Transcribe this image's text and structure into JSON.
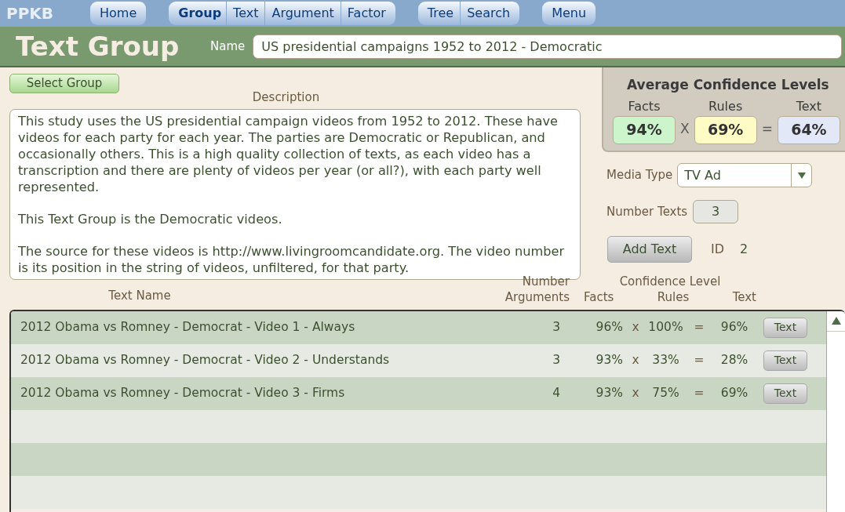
{
  "nav": {
    "brand": "PPKB",
    "groups": [
      [
        {
          "label": "Home",
          "selected": false
        }
      ],
      [
        {
          "label": "Group",
          "selected": true
        },
        {
          "label": "Text",
          "selected": false
        },
        {
          "label": "Argument",
          "selected": false
        },
        {
          "label": "Factor",
          "selected": false
        }
      ],
      [
        {
          "label": "Tree",
          "selected": false
        },
        {
          "label": "Search",
          "selected": false
        }
      ],
      [
        {
          "label": "Menu",
          "selected": false
        }
      ]
    ]
  },
  "header": {
    "title": "Text Group",
    "name_label": "Name",
    "name_value": "US presidential campaigns 1952 to 2012 - Democratic"
  },
  "select_button": "Select Group",
  "description": {
    "label": "Description",
    "paragraphs": [
      "This study uses the US presidential campaign videos from 1952 to 2012. These have videos for each party for each year. The parties are Democratic or Republican, and occasionally others.  This is a high quality collection of texts, as each video has a transcription and there are plenty of videos per year (or all?), with each party well represented.",
      "This Text Group is the Democratic videos.",
      "The source for these videos is http://www.livingroomcandidate.org. The video number is its position in the string of videos, unfiltered, for that party."
    ]
  },
  "average": {
    "title": "Average Confidence Levels",
    "items": [
      {
        "label": "Facts",
        "value": "94%",
        "color": "#ccf5cc"
      },
      {
        "op": "X"
      },
      {
        "label": "Rules",
        "value": "69%",
        "color": "#fefcc4"
      },
      {
        "op": "="
      },
      {
        "label": "Text",
        "value": "64%",
        "color": "#e2e8f8"
      }
    ]
  },
  "media_type": {
    "label": "Media Type",
    "value": "TV Ad"
  },
  "number_texts": {
    "label": "Number Texts",
    "value": "3"
  },
  "add_text_button": "Add Text",
  "id": {
    "label": "ID",
    "value": "2"
  },
  "table": {
    "columns": {
      "name": "Text Name",
      "arguments": [
        "Number",
        "Arguments"
      ],
      "confidence": "Confidence Level",
      "facts": "Facts",
      "rules": "Rules",
      "text": "Text"
    },
    "rows": [
      {
        "name": "2012 Obama vs Romney - Democrat - Video 1 - Always",
        "arguments": "3",
        "facts": "96%",
        "times": "x",
        "rules": "100%",
        "equals": "=",
        "text": "96%",
        "button": "Text"
      },
      {
        "name": "2012 Obama vs Romney - Democrat - Video 2 - Understands",
        "arguments": "3",
        "facts": "93%",
        "times": "x",
        "rules": "33%",
        "equals": "=",
        "text": "28%",
        "button": "Text"
      },
      {
        "name": "2012 Obama vs Romney - Democrat - Video 3 - Firms",
        "arguments": "4",
        "facts": "93%",
        "times": "x",
        "rules": "75%",
        "equals": "=",
        "text": "69%",
        "button": "Text"
      }
    ]
  }
}
